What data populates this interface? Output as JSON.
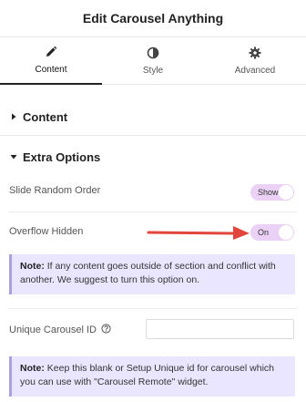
{
  "header": {
    "title": "Edit Carousel Anything"
  },
  "tabs": [
    {
      "label": "Content",
      "icon": "pencil-icon",
      "active": true
    },
    {
      "label": "Style",
      "icon": "half-circle-icon",
      "active": false
    },
    {
      "label": "Advanced",
      "icon": "gear-icon",
      "active": false
    }
  ],
  "sections": {
    "content": {
      "label": "Content"
    },
    "extra_options": {
      "label": "Extra Options"
    }
  },
  "controls": {
    "slide_random_order": {
      "label": "Slide Random Order",
      "toggle_text": "Show"
    },
    "overflow_hidden": {
      "label": "Overflow Hidden",
      "toggle_text": "On"
    },
    "overflow_note": {
      "prefix": "Note:",
      "text": " If any content goes outside of section and conflict with another. We suggest to turn this option on."
    },
    "unique_id": {
      "label": "Unique Carousel ID",
      "value": ""
    },
    "unique_note": {
      "prefix": "Note:",
      "text": " Keep this blank or Setup Unique id for carousel which you can use with \"Carousel Remote\" widget."
    }
  },
  "colors": {
    "toggle_bg": "#ead1f5",
    "notice_bg": "#ebe6ff",
    "arrow": "#e2453b"
  }
}
